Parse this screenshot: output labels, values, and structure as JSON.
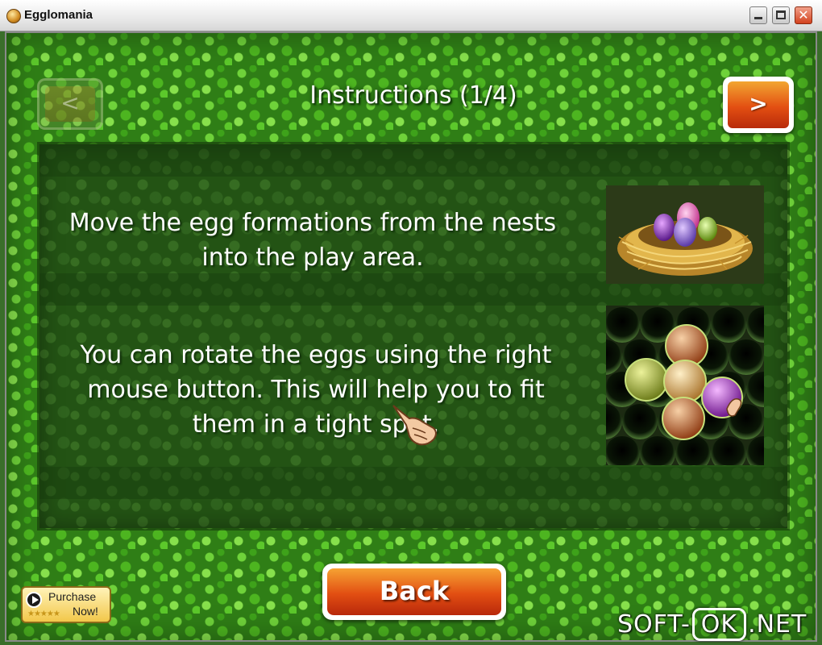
{
  "window": {
    "title": "Egglomania",
    "close_glyph": "✕"
  },
  "screen": {
    "heading": "Instructions (1/4)",
    "prev_label": "<",
    "next_label": ">",
    "paragraph1": "Move the egg formations from the nests into the play area.",
    "paragraph2": "You can rotate the eggs using the right mouse button. This will help you to fit them in a tight spot.",
    "back_label": "Back",
    "purchase_line1": "Purchase",
    "purchase_line2": "Now!",
    "purchase_stars": "★★★★★"
  },
  "watermark": {
    "left": "SOFT-",
    "middle": "OK",
    "right": ".NET"
  },
  "colors": {
    "button_orange": "#e34f12",
    "mosaic_green": "#4db520",
    "panel_green": "#235314"
  },
  "icons": [
    "app-egg-icon",
    "minimize-icon",
    "maximize-icon",
    "close-icon",
    "nest-with-eggs-image",
    "egg-grid-image",
    "pointing-hand-cursor-icon",
    "play-icon"
  ]
}
